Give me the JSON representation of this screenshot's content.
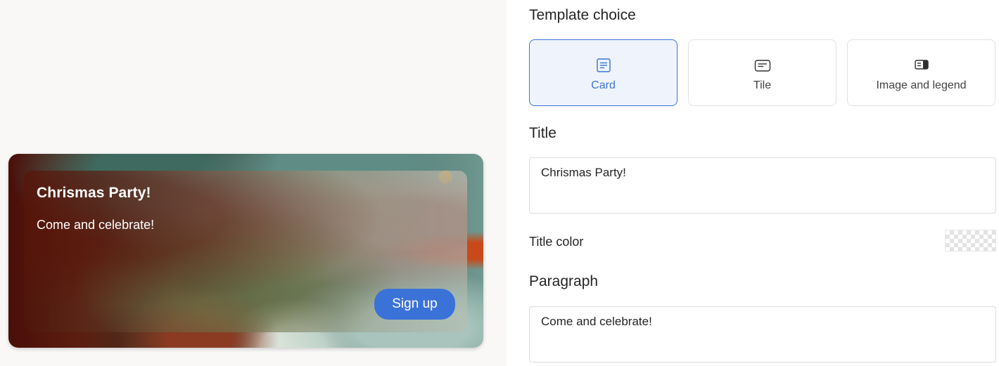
{
  "preview": {
    "title": "Chrismas Party!",
    "paragraph": "Come and celebrate!",
    "button_label": "Sign up"
  },
  "settings": {
    "template_heading": "Template choice",
    "templates": [
      {
        "label": "Card",
        "icon": "card-template-icon",
        "selected": true
      },
      {
        "label": "Tile",
        "icon": "tile-template-icon",
        "selected": false
      },
      {
        "label": "Image and legend",
        "icon": "image-legend-template-icon",
        "selected": false
      }
    ],
    "title_heading": "Title",
    "title_value": "Chrismas Party!",
    "title_color_label": "Title color",
    "paragraph_heading": "Paragraph",
    "paragraph_value": "Come and celebrate!"
  },
  "colors": {
    "accent": "#3b72d8",
    "selected_bg": "#eff4fc",
    "preview_bg": "#f9f8f7"
  }
}
